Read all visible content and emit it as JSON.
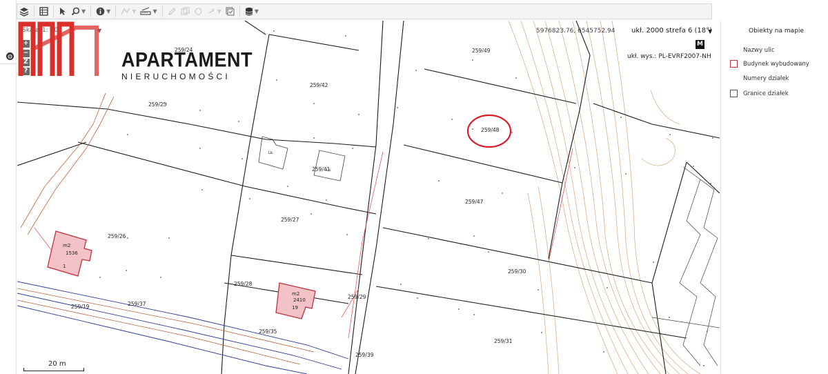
{
  "scale": {
    "label": "Skala:",
    "value": "1: 500"
  },
  "coordinates": "5976823.76, 6545752.94",
  "crs": "ukł. 2000 strefa 6 (18°)",
  "height_system": "ukł. wys.: PL-EVRF2007-NH",
  "map_badge": "M",
  "scale_bar": "20 m",
  "zoom": {
    "in": "+",
    "out": "−",
    "extent": "Z",
    "help": "?"
  },
  "logo": {
    "title": "APARTAMENT",
    "subtitle": "NIERUCHOMOŚCI"
  },
  "panel": {
    "title": "Obiekty na mapie",
    "layers": [
      {
        "label": "Nazwy ulic",
        "checkbox": false
      },
      {
        "label": "Budynek wybudowany",
        "checkbox": true
      },
      {
        "label": "Numery działek",
        "checkbox": false
      },
      {
        "label": "Granice działek",
        "checkbox": true
      }
    ]
  },
  "parcels": [
    {
      "id": "259/24"
    },
    {
      "id": "259/25"
    },
    {
      "id": "259/42"
    },
    {
      "id": "259/41"
    },
    {
      "id": "259/49"
    },
    {
      "id": "259/48"
    },
    {
      "id": "259/47"
    },
    {
      "id": "259/27"
    },
    {
      "id": "259/26"
    },
    {
      "id": "259/28"
    },
    {
      "id": "259/29"
    },
    {
      "id": "259/30"
    },
    {
      "id": "259/31"
    },
    {
      "id": "259/37"
    },
    {
      "id": "259/19"
    },
    {
      "id": "259/35"
    },
    {
      "id": "259/39"
    }
  ],
  "buildings": [
    {
      "type": "m2",
      "area": "1536",
      "number": "1"
    },
    {
      "type": "m2",
      "area": "2410",
      "number": "19"
    }
  ],
  "building_labels": {
    "lb1": "Lb.",
    "lb2": "Lb."
  },
  "highlight_color": "#d81e2c",
  "building_color": "#c0313f"
}
